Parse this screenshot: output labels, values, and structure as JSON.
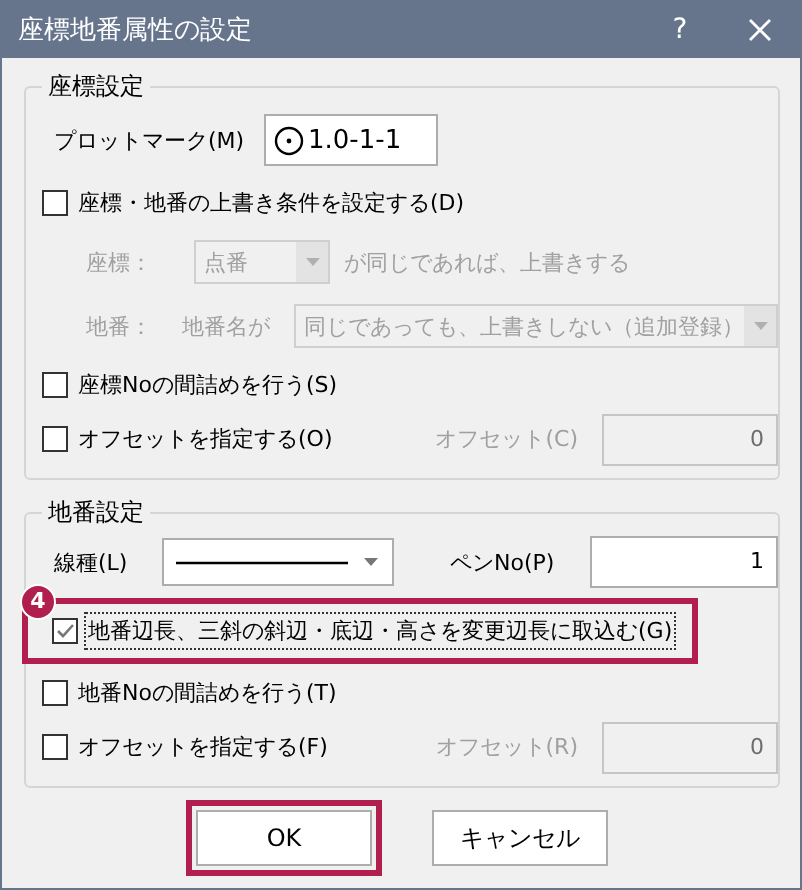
{
  "window": {
    "title": "座標地番属性の設定",
    "help": "?"
  },
  "groups": [
    {
      "title": "座標設定",
      "rows": [
        {
          "kind": "field",
          "label": "プロットマーク(M)",
          "value": "1.0-1-1"
        },
        {
          "kind": "checkbox",
          "label": "座標・地番の上書き条件を設定する(D)",
          "checked": false,
          "focused": false,
          "highlighted": false
        },
        {
          "kind": "combo",
          "disabled": true,
          "labels": [
            "座標："
          ],
          "value": "点番",
          "suffix": "が同じであれば、上書きする"
        },
        {
          "kind": "combo",
          "disabled": true,
          "labels": [
            "地番：",
            "地番名が"
          ],
          "value": "同じであっても、上書きしない（追加登録）"
        },
        {
          "kind": "checkbox",
          "label": "座標Noの間詰めを行う(S)",
          "checked": false,
          "focused": false,
          "highlighted": false
        },
        {
          "kind": "checkbox",
          "label": "オフセットを指定する(O)",
          "checked": false,
          "focused": false,
          "highlighted": false,
          "offset": {
            "label": "オフセット(C)",
            "value": "0",
            "disabled": true
          }
        }
      ]
    },
    {
      "title": "地番設定",
      "rows": [
        {
          "kind": "line_pen",
          "label": "線種(L)",
          "pen_label": "ペンNo(P)",
          "pen_value": "1"
        },
        {
          "kind": "checkbox",
          "label": "地番辺長、三斜の斜辺・底辺・高さを変更辺長に取込む(G)",
          "checked": true,
          "focused": true,
          "highlighted": true,
          "badge": "4"
        },
        {
          "kind": "checkbox",
          "label": "地番Noの間詰めを行う(T)",
          "checked": false,
          "focused": false,
          "highlighted": false
        },
        {
          "kind": "checkbox",
          "label": "オフセットを指定する(F)",
          "checked": false,
          "focused": false,
          "highlighted": false,
          "offset": {
            "label": "オフセット(R)",
            "value": "0",
            "disabled": true
          }
        }
      ]
    }
  ],
  "buttons": [
    {
      "label": "OK",
      "highlighted": true
    },
    {
      "label": "キャンセル",
      "highlighted": false
    }
  ]
}
